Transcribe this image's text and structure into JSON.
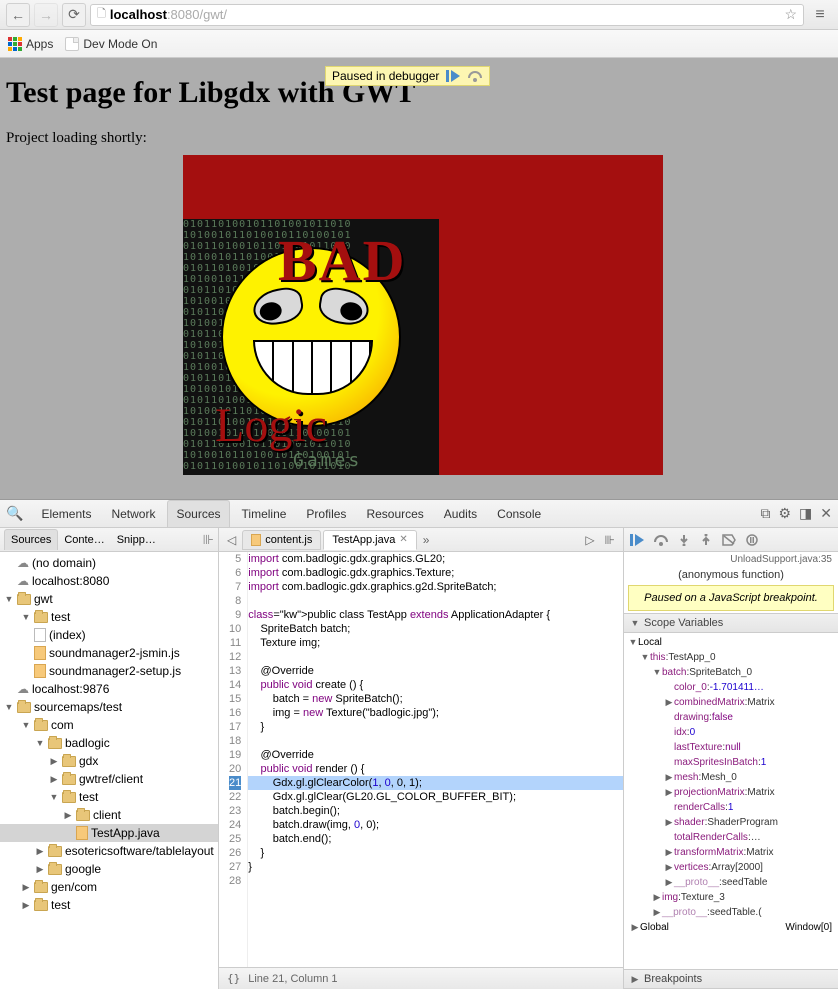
{
  "browser": {
    "url_host": "localhost",
    "url_port": ":8080",
    "url_path": "/gwt/",
    "bookmarks": {
      "apps": "Apps",
      "devmode": "Dev Mode On"
    }
  },
  "page": {
    "title": "Test page for Libgdx with GWT",
    "loading": "Project loading shortly:",
    "logo": {
      "bad": "BAD",
      "logic": "Logic",
      "games": "Games"
    },
    "debug_overlay": "Paused in debugger"
  },
  "devtools": {
    "tabs": [
      "Elements",
      "Network",
      "Sources",
      "Timeline",
      "Profiles",
      "Resources",
      "Audits",
      "Console"
    ],
    "active_tab": "Sources",
    "left_tabs": [
      "Sources",
      "Conte…",
      "Snipp…"
    ],
    "tree": {
      "nodomain": "(no domain)",
      "localhost8080": "localhost:8080",
      "gwt": "gwt",
      "test": "test",
      "index": "(index)",
      "sm_jsmin": "soundmanager2-jsmin.js",
      "sm_setup": "soundmanager2-setup.js",
      "localhost9876": "localhost:9876",
      "sourcemaps": "sourcemaps/test",
      "com": "com",
      "badlogic": "badlogic",
      "gdx": "gdx",
      "gwtref": "gwtref/client",
      "test2": "test",
      "client": "client",
      "testapp": "TestApp.java",
      "esoteric": "esotericsoftware/tablelayout",
      "google": "google",
      "gen": "gen/com",
      "test3": "test"
    },
    "code_tabs": {
      "content": "content.js",
      "testapp": "TestApp.java",
      "more": "»"
    },
    "code": {
      "lines": [
        {
          "n": 5,
          "t": "import com.badlogic.gdx.graphics.GL20;",
          "kw": "import"
        },
        {
          "n": 6,
          "t": "import com.badlogic.gdx.graphics.Texture;",
          "kw": "import"
        },
        {
          "n": 7,
          "t": "import com.badlogic.gdx.graphics.g2d.SpriteBatch;",
          "kw": "import"
        },
        {
          "n": 8,
          "t": ""
        },
        {
          "n": 9,
          "t": "public class TestApp extends ApplicationAdapter {",
          "kw": "public class extends"
        },
        {
          "n": 10,
          "t": "    SpriteBatch batch;"
        },
        {
          "n": 11,
          "t": "    Texture img;"
        },
        {
          "n": 12,
          "t": ""
        },
        {
          "n": 13,
          "t": "    @Override"
        },
        {
          "n": 14,
          "t": "    public void create () {",
          "kw": "public void"
        },
        {
          "n": 15,
          "t": "        batch = new SpriteBatch();",
          "kw": "new"
        },
        {
          "n": 16,
          "t": "        img = new Texture(\"badlogic.jpg\");",
          "kw": "new",
          "str": "\"badlogic.jpg\""
        },
        {
          "n": 17,
          "t": "    }"
        },
        {
          "n": 18,
          "t": ""
        },
        {
          "n": 19,
          "t": "    @Override"
        },
        {
          "n": 20,
          "t": "    public void render () {",
          "kw": "public void"
        },
        {
          "n": 21,
          "t": "        Gdx.gl.glClearColor(1, 0, 0, 1);",
          "hl": true,
          "nums": "1 0 0 1"
        },
        {
          "n": 22,
          "t": "        Gdx.gl.glClear(GL20.GL_COLOR_BUFFER_BIT);"
        },
        {
          "n": 23,
          "t": "        batch.begin();"
        },
        {
          "n": 24,
          "t": "        batch.draw(img, 0, 0);",
          "nums": "0 0"
        },
        {
          "n": 25,
          "t": "        batch.end();"
        },
        {
          "n": 26,
          "t": "    }"
        },
        {
          "n": 27,
          "t": "}"
        },
        {
          "n": 28,
          "t": ""
        }
      ]
    },
    "status": {
      "line_col": "Line 21, Column 1"
    },
    "debugger": {
      "source_link": "UnloadSupport.java:35",
      "anon": "(anonymous function)",
      "paused_msg": "Paused on a JavaScript breakpoint.",
      "sections": {
        "scope": "Scope Variables",
        "breakpoints": "Breakpoints"
      },
      "local": "Local",
      "global": "Global",
      "global_val": "Window[0]",
      "scope": [
        {
          "d": 1,
          "tw": "▼",
          "name": "this",
          "val": "TestApp_0"
        },
        {
          "d": 2,
          "tw": "▼",
          "name": "batch",
          "val": "SpriteBatch_0"
        },
        {
          "d": 3,
          "tw": "",
          "name": "color_0",
          "val": "-1.701411…",
          "cls": "num"
        },
        {
          "d": 3,
          "tw": "▶",
          "name": "combinedMatrix",
          "val": "Matrix"
        },
        {
          "d": 3,
          "tw": "",
          "name": "drawing",
          "val": "false",
          "cls": "kw"
        },
        {
          "d": 3,
          "tw": "",
          "name": "idx",
          "val": "0",
          "cls": "num"
        },
        {
          "d": 3,
          "tw": "",
          "name": "lastTexture",
          "val": "null",
          "cls": "kw"
        },
        {
          "d": 3,
          "tw": "",
          "name": "maxSpritesInBatch",
          "val": "1",
          "cls": "num"
        },
        {
          "d": 3,
          "tw": "▶",
          "name": "mesh",
          "val": "Mesh_0"
        },
        {
          "d": 3,
          "tw": "▶",
          "name": "projectionMatrix",
          "val": "Matrix"
        },
        {
          "d": 3,
          "tw": "",
          "name": "renderCalls",
          "val": "1",
          "cls": "num"
        },
        {
          "d": 3,
          "tw": "▶",
          "name": "shader",
          "val": "ShaderProgram"
        },
        {
          "d": 3,
          "tw": "",
          "name": "totalRenderCalls",
          "val": "…"
        },
        {
          "d": 3,
          "tw": "▶",
          "name": "transformMatrix",
          "val": "Matrix"
        },
        {
          "d": 3,
          "tw": "▶",
          "name": "vertices",
          "val": "Array[2000]"
        },
        {
          "d": 3,
          "tw": "▶",
          "name": "__proto__",
          "val": "seedTable",
          "proto": true
        },
        {
          "d": 2,
          "tw": "▶",
          "name": "img",
          "val": "Texture_3"
        },
        {
          "d": 2,
          "tw": "▶",
          "name": "__proto__",
          "val": "seedTable.(",
          "proto": true
        }
      ]
    }
  }
}
